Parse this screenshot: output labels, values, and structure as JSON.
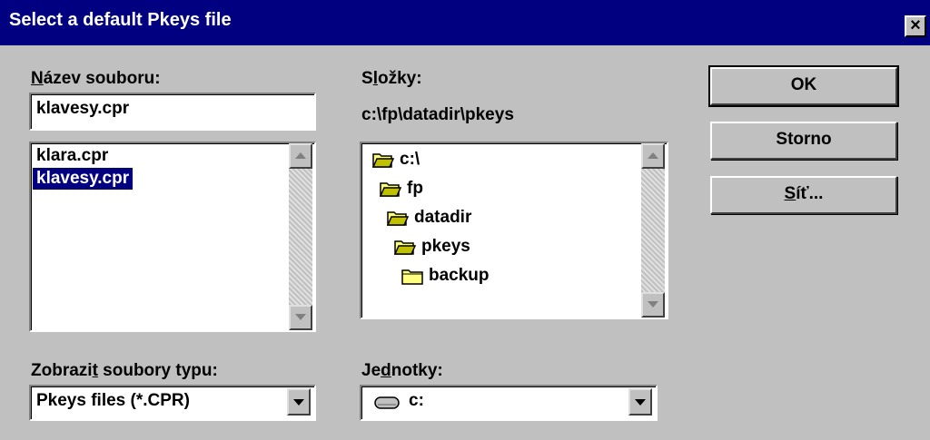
{
  "window": {
    "title": "Select a default Pkeys file",
    "close_glyph": "×"
  },
  "filename": {
    "label_mnemonic": "N",
    "label_rest": "ázev souboru:",
    "value": "klavesy.cpr"
  },
  "files": [
    {
      "name": "klara.cpr",
      "selected": false
    },
    {
      "name": "klavesy.cpr",
      "selected": true
    }
  ],
  "folders": {
    "label_before": "S",
    "label_mnemonic": "l",
    "label_after": "ožky:",
    "current_path": "c:\\fp\\datadir\\pkeys",
    "items": [
      {
        "name": "c:\\",
        "icon": "open-folder-icon"
      },
      {
        "name": "fp",
        "icon": "open-folder-icon"
      },
      {
        "name": "datadir",
        "icon": "open-folder-icon"
      },
      {
        "name": "pkeys",
        "icon": "open-folder-icon"
      },
      {
        "name": "backup",
        "icon": "closed-folder-icon"
      }
    ]
  },
  "file_type": {
    "label_before": "Zobrazi",
    "label_mnemonic": "t",
    "label_after": " soubory typu:",
    "value": "Pkeys files (*.CPR)"
  },
  "drives": {
    "label_before": "Je",
    "label_mnemonic": "d",
    "label_after": "notky:",
    "value": "c:",
    "icon": "hard-drive-icon"
  },
  "buttons": {
    "ok": "OK",
    "cancel": "Storno",
    "network_mnemonic": "S",
    "network_rest": "íť..."
  },
  "colors": {
    "titlebar": "#000080",
    "face": "#c0c0c0",
    "selection": "#000080",
    "folder": "#ffff80"
  }
}
